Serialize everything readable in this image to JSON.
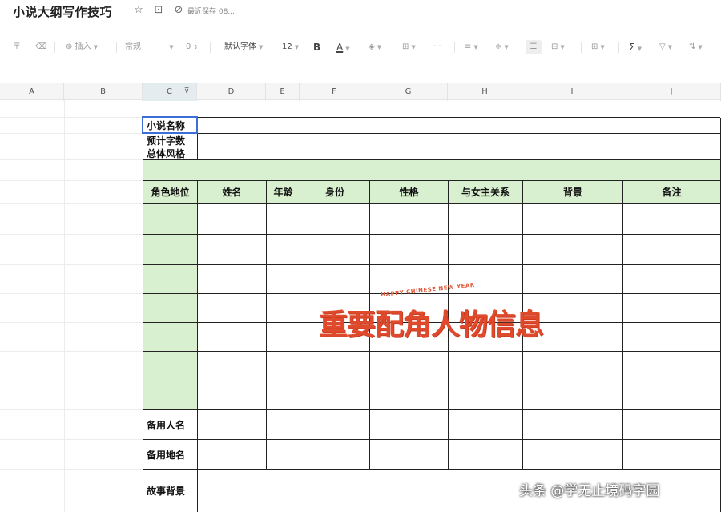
{
  "titlebar": {
    "title": "小说大纲写作技巧",
    "save_status": "最近保存 08..."
  },
  "toolbar": {
    "insert_label": "插入",
    "format_value": "常规",
    "number_value": "0",
    "font_value": "默认字体",
    "font_size_value": "12",
    "bold_label": "B",
    "font_color_label": "A",
    "more_label": "···",
    "sum_label": "Σ"
  },
  "sheet": {
    "columns": [
      "A",
      "B",
      "C",
      "D",
      "E",
      "F",
      "G",
      "H",
      "I",
      "J"
    ]
  },
  "table": {
    "novel_name_label": "小说名称",
    "word_count_label": "预计字数",
    "style_label": "总体风格",
    "headers": [
      "角色地位",
      "姓名",
      "年龄",
      "身份",
      "性格",
      "与女主关系",
      "背景",
      "备注"
    ],
    "backup_name_label": "备用人名",
    "backup_place_label": "备用地名",
    "story_background_label": "故事背景"
  },
  "watermark": {
    "small_text": "HAPPY CHINESE NEW YEAR",
    "big_text": "重要配角人物信息"
  },
  "credit": "头条 @学无止境码字园",
  "colors": {
    "header_green": "#d9f0d0",
    "selection_blue": "#3b6fd6",
    "watermark_red": "#e04a2c"
  }
}
